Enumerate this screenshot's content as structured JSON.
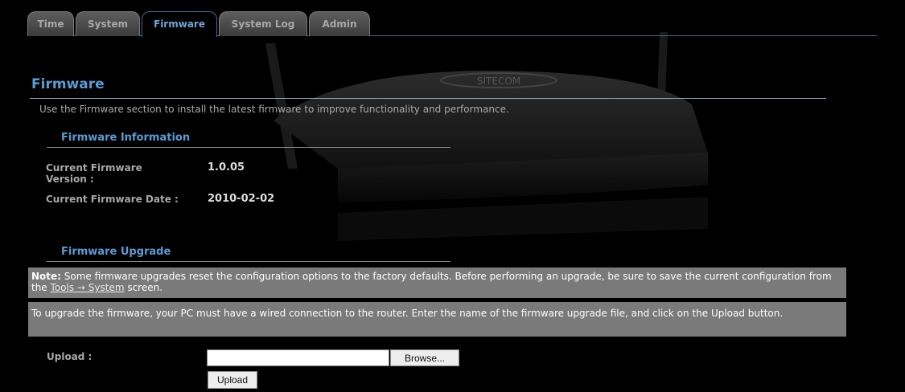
{
  "tabs": [
    {
      "label": "Time"
    },
    {
      "label": "System"
    },
    {
      "label": "Firmware"
    },
    {
      "label": "System Log"
    },
    {
      "label": "Admin"
    }
  ],
  "page": {
    "title": "Firmware",
    "intro": "Use the Firmware section to install the latest firmware to improve functionality and performance."
  },
  "info": {
    "heading": "Firmware Information",
    "version_label_line1": "Current Firmware",
    "version_label_line2": "Version :",
    "version_value": "1.0.05",
    "date_label": "Current Firmware Date :",
    "date_value": "2010-02-02"
  },
  "upgrade": {
    "heading": "Firmware Upgrade",
    "note_bold": "Note:",
    "note_text": " Some firmware upgrades reset the configuration options to the factory defaults. Before performing an upgrade, be sure to save the current configuration from the ",
    "note_link": "Tools → System",
    "note_tail": " screen.",
    "instructions": "To upgrade the firmware, your PC must have a wired connection to the router. Enter the name of the firmware upgrade file, and click on the Upload button.",
    "upload_label": "Upload :",
    "file_value": "",
    "browse_label": "Browse...",
    "upload_button": "Upload"
  },
  "brand": "SITECOM",
  "colors": {
    "accent": "#5a9cd4",
    "note_bg": "#7a7a7a"
  }
}
